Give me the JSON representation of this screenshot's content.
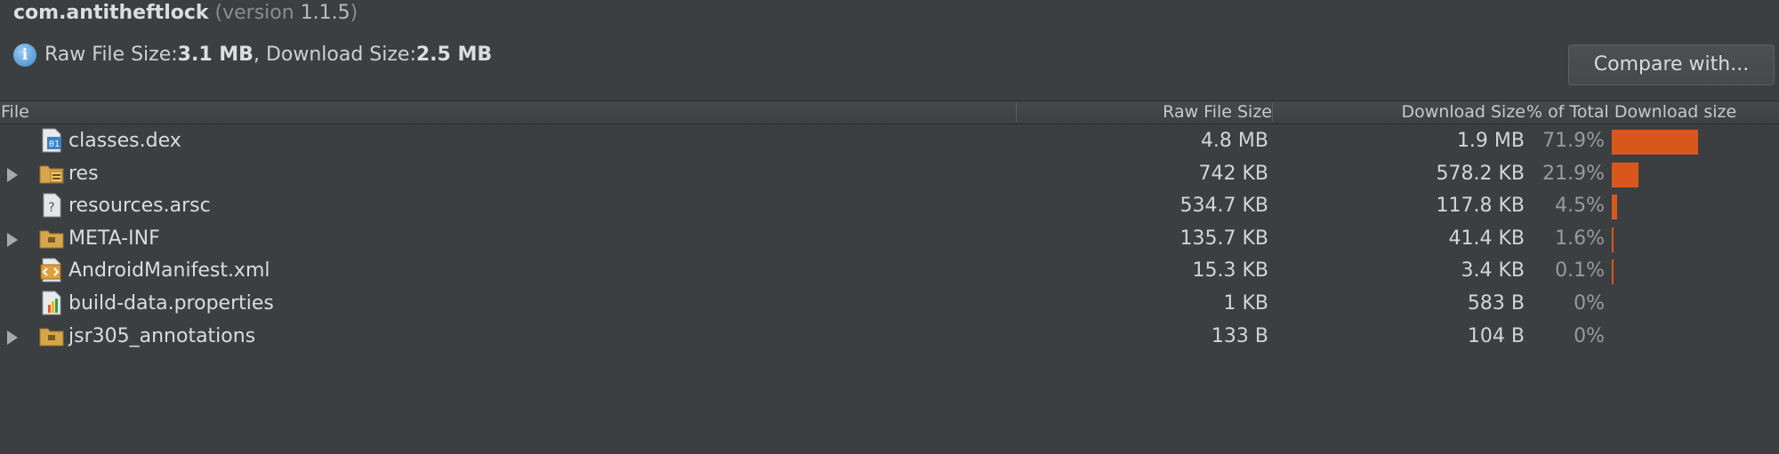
{
  "header": {
    "package_name": "com.antitheftlock",
    "version_prefix": " (version ",
    "version_number": "1.1.5",
    "version_suffix": ")"
  },
  "summary": {
    "info_icon": "info-icon",
    "raw_label": "Raw File Size: ",
    "raw_value": "3.1 MB",
    "separator": ", Download Size: ",
    "download_value": "2.5 MB"
  },
  "compare_button": {
    "label": "Compare with..."
  },
  "table": {
    "columns": {
      "file": "File",
      "raw": "Raw File Size",
      "download": "Download Size",
      "percent": "% of Total Download size"
    },
    "bar_color": "#d9571c",
    "rows": [
      {
        "name": "classes.dex",
        "icon": "dex-file-icon",
        "expandable": false,
        "raw": "4.8 MB",
        "download": "1.9 MB",
        "percent": "71.9%",
        "percent_value": 71.9
      },
      {
        "name": "res",
        "icon": "resources-folder-icon",
        "expandable": true,
        "raw": "742 KB",
        "download": "578.2 KB",
        "percent": "21.9%",
        "percent_value": 21.9
      },
      {
        "name": "resources.arsc",
        "icon": "unknown-file-icon",
        "expandable": false,
        "raw": "534.7 KB",
        "download": "117.8 KB",
        "percent": "4.5%",
        "percent_value": 4.5
      },
      {
        "name": "META-INF",
        "icon": "folder-icon",
        "expandable": true,
        "raw": "135.7 KB",
        "download": "41.4 KB",
        "percent": "1.6%",
        "percent_value": 1.6
      },
      {
        "name": "AndroidManifest.xml",
        "icon": "xml-file-icon",
        "expandable": false,
        "raw": "15.3 KB",
        "download": "3.4 KB",
        "percent": "0.1%",
        "percent_value": 0.1
      },
      {
        "name": "build-data.properties",
        "icon": "properties-file-icon",
        "expandable": false,
        "raw": "1 KB",
        "download": "583 B",
        "percent": "0%",
        "percent_value": 0
      },
      {
        "name": "jsr305_annotations",
        "icon": "folder-icon",
        "expandable": true,
        "raw": "133 B",
        "download": "104 B",
        "percent": "0%",
        "percent_value": 0
      }
    ]
  }
}
